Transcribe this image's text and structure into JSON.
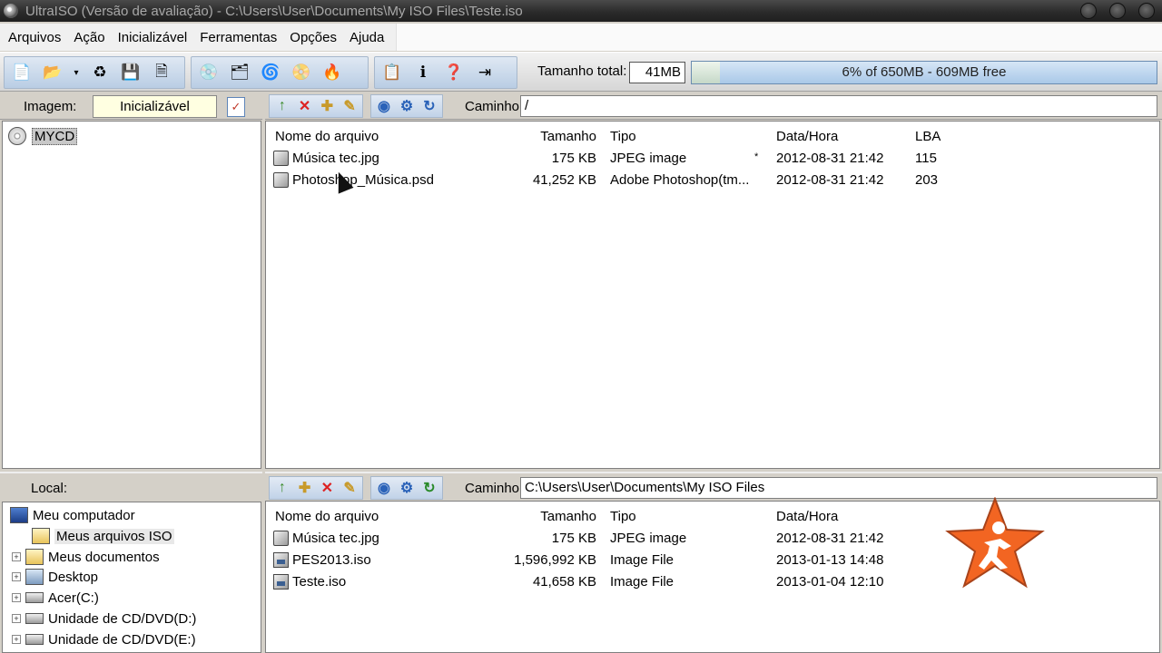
{
  "window": {
    "title": "UltraISO (Versão de avaliação) - C:\\Users\\User\\Documents\\My ISO Files\\Teste.iso"
  },
  "menu": [
    "Arquivos",
    "Ação",
    "Inicializável",
    "Ferramentas",
    "Opções",
    "Ajuda"
  ],
  "toolbar": {
    "total_label": "Tamanho total:",
    "total_value": "41MB",
    "capacity_text": "6% of 650MB - 609MB free",
    "capacity_fraction": 0.06,
    "icons": [
      "new-icon",
      "open-icon",
      "dropdown-icon",
      "extract-icon",
      "save-icon",
      "save-as-icon",
      "mount-icon",
      "burn-icon",
      "compress-icon",
      "disk-image-icon",
      "virtual-drive-icon",
      "convert-icon",
      "info-icon",
      "help-icon",
      "exit-icon"
    ]
  },
  "image_pane": {
    "label": "Imagem:",
    "boot_label": "Inicializável",
    "root_name": "MYCD"
  },
  "iso_pane": {
    "path_label": "Caminho:",
    "path": "/",
    "columns": [
      "Nome do arquivo",
      "Tamanho",
      "Tipo",
      "Data/Hora",
      "LBA"
    ],
    "rows": [
      {
        "name": "Música tec.jpg",
        "size": "175 KB",
        "type": "JPEG image",
        "flag": "*",
        "date": "2012-08-31 21:42",
        "lba": "115"
      },
      {
        "name": "Photoshop_Música.psd",
        "size": "41,252 KB",
        "type": "Adobe Photoshop(tm...",
        "flag": "",
        "date": "2012-08-31 21:42",
        "lba": "203"
      }
    ]
  },
  "local_pane": {
    "label": "Local:",
    "path_label": "Caminho:",
    "path": "C:\\Users\\User\\Documents\\My ISO Files",
    "tree": [
      "Meu computador",
      "Meus arquivos ISO",
      "Meus documentos",
      "Desktop",
      "Acer(C:)",
      "Unidade de CD/DVD(D:)",
      "Unidade de CD/DVD(E:)"
    ],
    "columns": [
      "Nome do arquivo",
      "Tamanho",
      "Tipo",
      "Data/Hora"
    ],
    "rows": [
      {
        "name": "Música tec.jpg",
        "size": "175 KB",
        "type": "JPEG image",
        "date": "2012-08-31 21:42"
      },
      {
        "name": "PES2013.iso",
        "size": "1,596,992 KB",
        "type": "Image File",
        "date": "2013-01-13 14:48"
      },
      {
        "name": "Teste.iso",
        "size": "41,658 KB",
        "type": "Image File",
        "date": "2013-01-04 12:10"
      }
    ]
  },
  "colors": {
    "accent_orange": "#f26522",
    "capacity_blue": "#a9c8e8"
  }
}
